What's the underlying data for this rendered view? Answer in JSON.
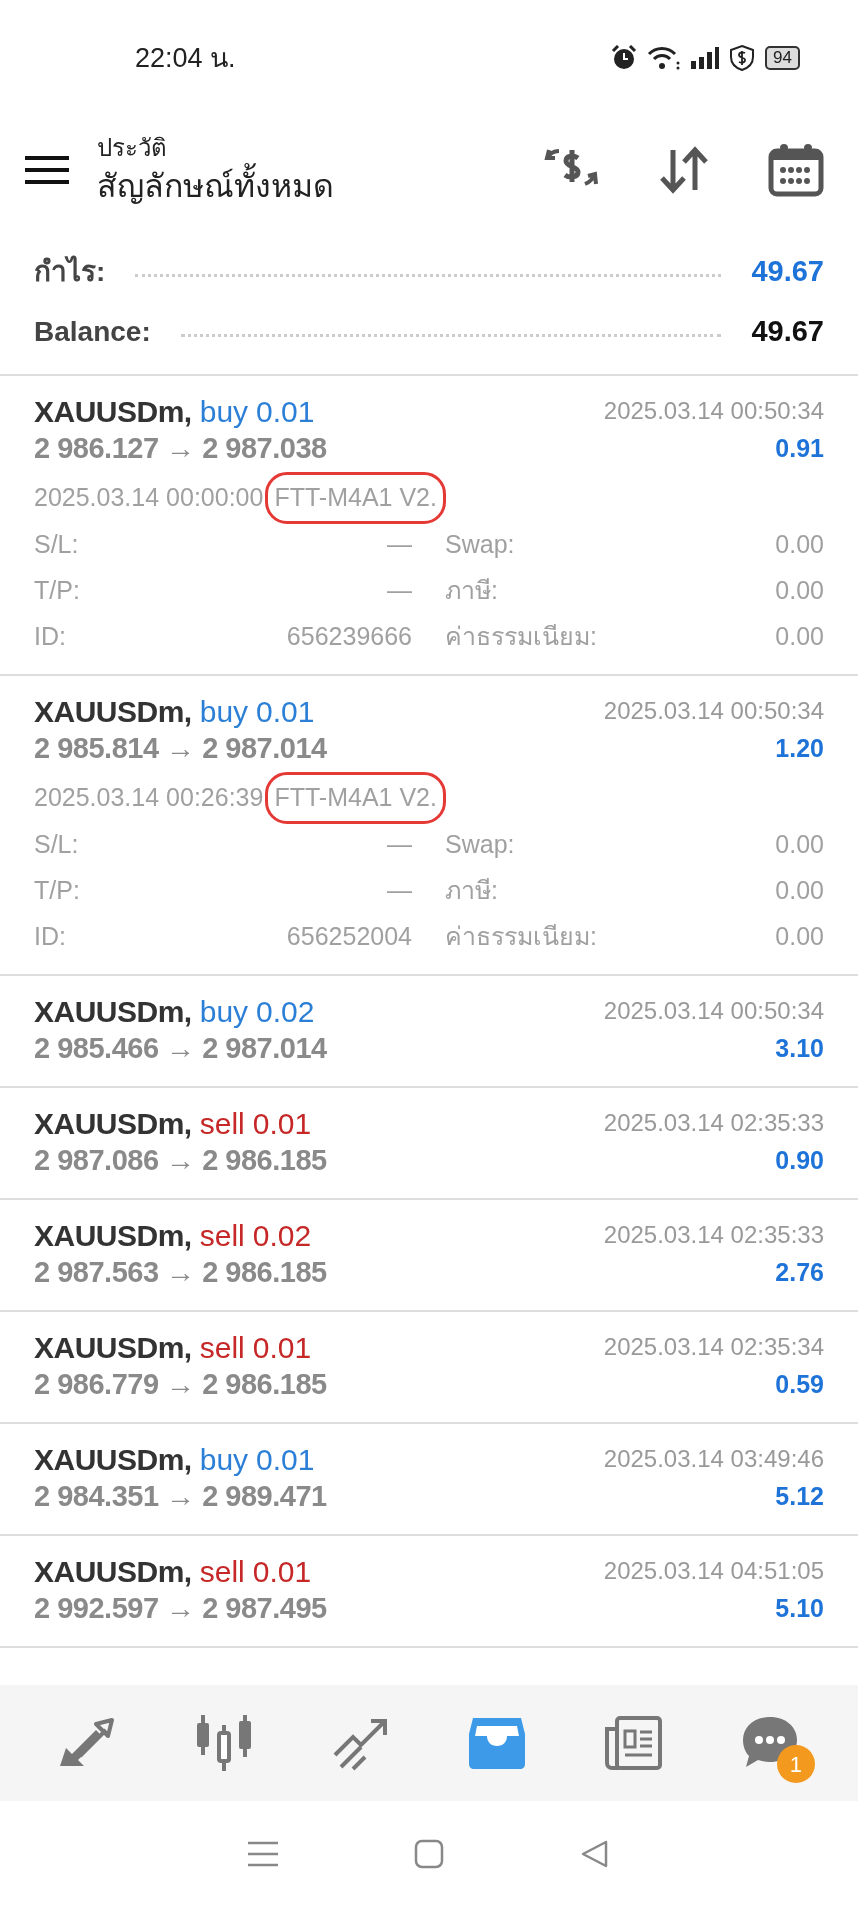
{
  "status_bar": {
    "time": "22:04 น.",
    "battery": "94"
  },
  "header": {
    "subtitle": "ประวัติ",
    "title": "สัญลักษณ์ทั้งหมด"
  },
  "summary": [
    {
      "kind": "profit",
      "label": "กำไร:",
      "value": "49.67"
    },
    {
      "kind": "balance",
      "label": "Balance:",
      "value": "49.67"
    }
  ],
  "trades": [
    {
      "symbol": "XAUUSDm,",
      "side": "buy",
      "volume": "0.01",
      "color": "#2b7fd6",
      "prices": "2 986.127 → 2 987.038",
      "time": "2025.03.14 00:50:34",
      "profit": "0.91",
      "expanded": true,
      "open_time": "2025.03.14 00:00:00",
      "comment": "FTT-M4A1 V2.",
      "circled": true,
      "details": [
        {
          "label": "S/L:",
          "value": "—"
        },
        {
          "label": "Swap:",
          "value": "0.00"
        },
        {
          "label": "T/P:",
          "value": "—"
        },
        {
          "label": "ภาษี:",
          "value": "0.00"
        },
        {
          "label": "ID:",
          "value": "656239666"
        },
        {
          "label": "ค่าธรรมเนียม:",
          "value": "0.00"
        }
      ]
    },
    {
      "symbol": "XAUUSDm,",
      "side": "buy",
      "volume": "0.01",
      "color": "#2b7fd6",
      "prices": "2 985.814 → 2 987.014",
      "time": "2025.03.14 00:50:34",
      "profit": "1.20",
      "expanded": true,
      "open_time": "2025.03.14 00:26:39",
      "comment": "FTT-M4A1 V2.",
      "circled": true,
      "details": [
        {
          "label": "S/L:",
          "value": "—"
        },
        {
          "label": "Swap:",
          "value": "0.00"
        },
        {
          "label": "T/P:",
          "value": "—"
        },
        {
          "label": "ภาษี:",
          "value": "0.00"
        },
        {
          "label": "ID:",
          "value": "656252004"
        },
        {
          "label": "ค่าธรรมเนียม:",
          "value": "0.00"
        }
      ]
    },
    {
      "symbol": "XAUUSDm,",
      "side": "buy",
      "volume": "0.02",
      "color": "#2b7fd6",
      "prices": "2 985.466 → 2 987.014",
      "time": "2025.03.14 00:50:34",
      "profit": "3.10",
      "expanded": false
    },
    {
      "symbol": "XAUUSDm,",
      "side": "sell",
      "volume": "0.01",
      "color": "#c62828",
      "prices": "2 987.086 → 2 986.185",
      "time": "2025.03.14 02:35:33",
      "profit": "0.90",
      "expanded": false
    },
    {
      "symbol": "XAUUSDm,",
      "side": "sell",
      "volume": "0.02",
      "color": "#c62828",
      "prices": "2 987.563 → 2 986.185",
      "time": "2025.03.14 02:35:33",
      "profit": "2.76",
      "expanded": false
    },
    {
      "symbol": "XAUUSDm,",
      "side": "sell",
      "volume": "0.01",
      "color": "#c62828",
      "prices": "2 986.779 → 2 986.185",
      "time": "2025.03.14 02:35:34",
      "profit": "0.59",
      "expanded": false
    },
    {
      "symbol": "XAUUSDm,",
      "side": "buy",
      "volume": "0.01",
      "color": "#2b7fd6",
      "prices": "2 984.351 → 2 989.471",
      "time": "2025.03.14 03:49:46",
      "profit": "5.12",
      "expanded": false
    },
    {
      "symbol": "XAUUSDm,",
      "side": "sell",
      "volume": "0.01",
      "color": "#c62828",
      "prices": "2 992.597 → 2 987.495",
      "time": "2025.03.14 04:51:05",
      "profit": "5.10",
      "expanded": false
    }
  ],
  "bottom_nav": [
    {
      "kind": "quotes",
      "selected": false
    },
    {
      "kind": "chart",
      "selected": false
    },
    {
      "kind": "trade",
      "selected": false
    },
    {
      "kind": "history",
      "selected": true
    },
    {
      "kind": "news",
      "selected": false
    },
    {
      "kind": "chat",
      "selected": false,
      "badge": "1"
    }
  ]
}
